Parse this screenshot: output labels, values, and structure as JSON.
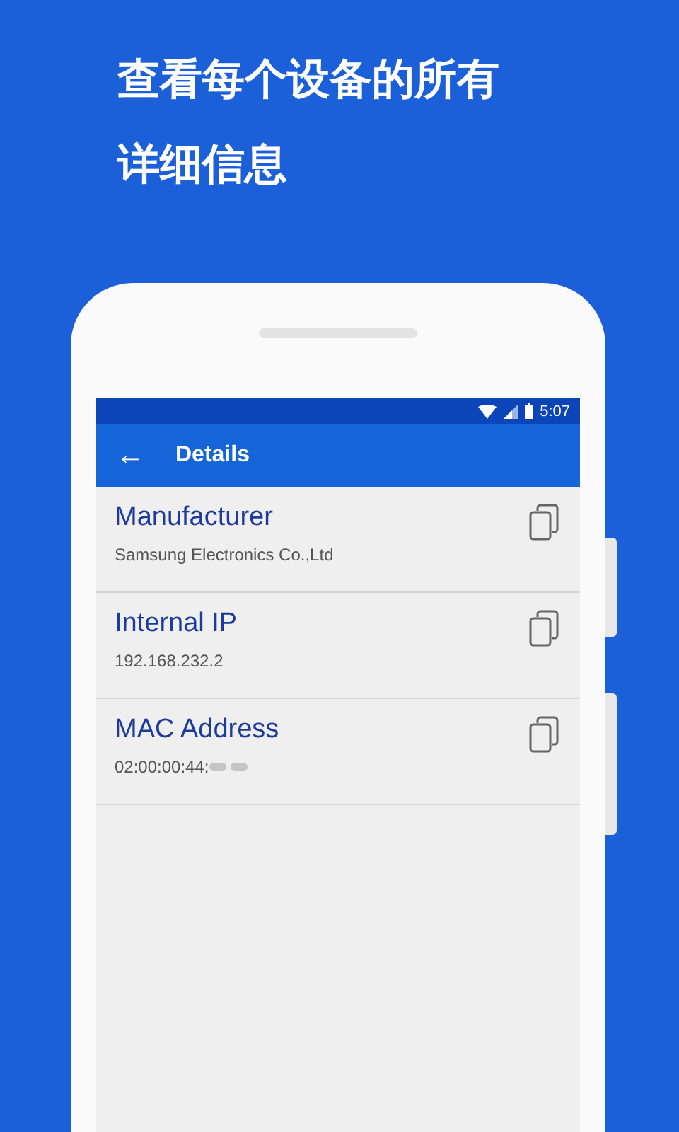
{
  "headline": [
    "查看每个设备的所有",
    "详细信息"
  ],
  "status_bar": {
    "time": "5:07"
  },
  "app_bar": {
    "back": "←",
    "title": "Details"
  },
  "items": [
    {
      "label": "Manufacturer",
      "value": "Samsung Electronics Co.,Ltd",
      "blurred": false
    },
    {
      "label": "Internal IP",
      "value": "192.168.232.2",
      "blurred": false
    },
    {
      "label": "MAC Address",
      "value": "02:00:00:44:",
      "blurred": true
    }
  ]
}
